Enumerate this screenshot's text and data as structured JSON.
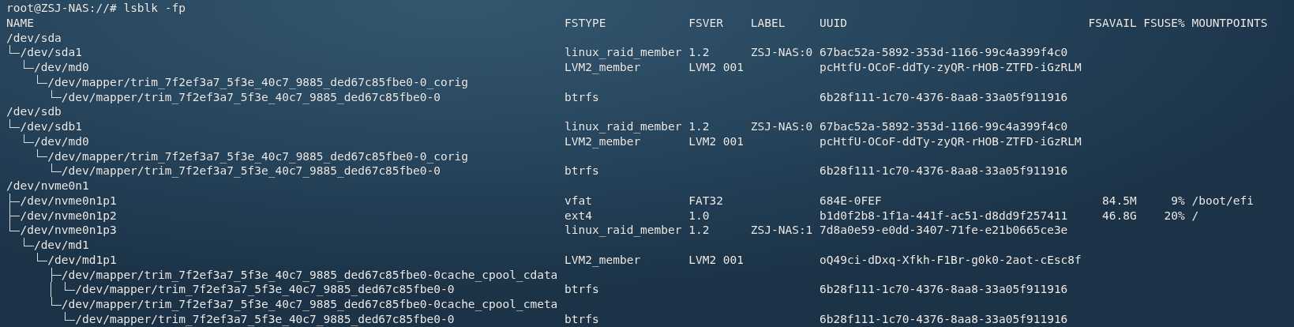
{
  "prompt": {
    "user_host": "root@ZSJ-NAS://#",
    "command": "lsblk -fp"
  },
  "columns": [
    "NAME",
    "FSTYPE",
    "FSVER",
    "LABEL",
    "UUID",
    "FSAVAIL",
    "FSUSE%",
    "MOUNTPOINTS"
  ],
  "devices": [
    {
      "name": "/dev/sda",
      "children": [
        {
          "name": "/dev/sda1",
          "fstype": "linux_raid_member",
          "fsver": "1.2",
          "label": "ZSJ-NAS:0",
          "uuid": "67bac52a-5892-353d-1166-99c4a399f4c0",
          "children": [
            {
              "name": "/dev/md0",
              "fstype": "LVM2_member",
              "fsver": "LVM2 001",
              "uuid": "pcHtfU-OCoF-ddTy-zyQR-rHOB-ZTFD-iGzRLM",
              "children": [
                {
                  "name": "/dev/mapper/trim_7f2ef3a7_5f3e_40c7_9885_ded67c85fbe0-0_corig",
                  "children": [
                    {
                      "name": "/dev/mapper/trim_7f2ef3a7_5f3e_40c7_9885_ded67c85fbe0-0",
                      "fstype": "btrfs",
                      "uuid": "6b28f111-1c70-4376-8aa8-33a05f911916"
                    }
                  ]
                }
              ]
            }
          ]
        }
      ]
    },
    {
      "name": "/dev/sdb",
      "children": [
        {
          "name": "/dev/sdb1",
          "fstype": "linux_raid_member",
          "fsver": "1.2",
          "label": "ZSJ-NAS:0",
          "uuid": "67bac52a-5892-353d-1166-99c4a399f4c0",
          "children": [
            {
              "name": "/dev/md0",
              "fstype": "LVM2_member",
              "fsver": "LVM2 001",
              "uuid": "pcHtfU-OCoF-ddTy-zyQR-rHOB-ZTFD-iGzRLM",
              "children": [
                {
                  "name": "/dev/mapper/trim_7f2ef3a7_5f3e_40c7_9885_ded67c85fbe0-0_corig",
                  "children": [
                    {
                      "name": "/dev/mapper/trim_7f2ef3a7_5f3e_40c7_9885_ded67c85fbe0-0",
                      "fstype": "btrfs",
                      "uuid": "6b28f111-1c70-4376-8aa8-33a05f911916"
                    }
                  ]
                }
              ]
            }
          ]
        }
      ]
    },
    {
      "name": "/dev/nvme0n1",
      "children": [
        {
          "name": "/dev/nvme0n1p1",
          "fstype": "vfat",
          "fsver": "FAT32",
          "uuid": "684E-0FEF",
          "fsavail": "84.5M",
          "fsuse": "9%",
          "mountpoints": "/boot/efi"
        },
        {
          "name": "/dev/nvme0n1p2",
          "fstype": "ext4",
          "fsver": "1.0",
          "uuid": "b1d0f2b8-1f1a-441f-ac51-d8dd9f257411",
          "fsavail": "46.8G",
          "fsuse": "20%",
          "mountpoints": "/"
        },
        {
          "name": "/dev/nvme0n1p3",
          "fstype": "linux_raid_member",
          "fsver": "1.2",
          "label": "ZSJ-NAS:1",
          "uuid": "7d8a0e59-e0dd-3407-71fe-e21b0665ce3e",
          "children": [
            {
              "name": "/dev/md1",
              "children": [
                {
                  "name": "/dev/md1p1",
                  "fstype": "LVM2_member",
                  "fsver": "LVM2 001",
                  "uuid": "oQ49ci-dDxq-Xfkh-F1Br-g0k0-2aot-cEsc8f",
                  "children": [
                    {
                      "name": "/dev/mapper/trim_7f2ef3a7_5f3e_40c7_9885_ded67c85fbe0-0cache_cpool_cdata",
                      "children": [
                        {
                          "name": "/dev/mapper/trim_7f2ef3a7_5f3e_40c7_9885_ded67c85fbe0-0",
                          "fstype": "btrfs",
                          "uuid": "6b28f111-1c70-4376-8aa8-33a05f911916"
                        }
                      ]
                    },
                    {
                      "name": "/dev/mapper/trim_7f2ef3a7_5f3e_40c7_9885_ded67c85fbe0-0cache_cpool_cmeta",
                      "children": [
                        {
                          "name": "/dev/mapper/trim_7f2ef3a7_5f3e_40c7_9885_ded67c85fbe0-0",
                          "fstype": "btrfs",
                          "uuid": "6b28f111-1c70-4376-8aa8-33a05f911916"
                        }
                      ]
                    }
                  ]
                }
              ]
            }
          ]
        }
      ]
    }
  ]
}
